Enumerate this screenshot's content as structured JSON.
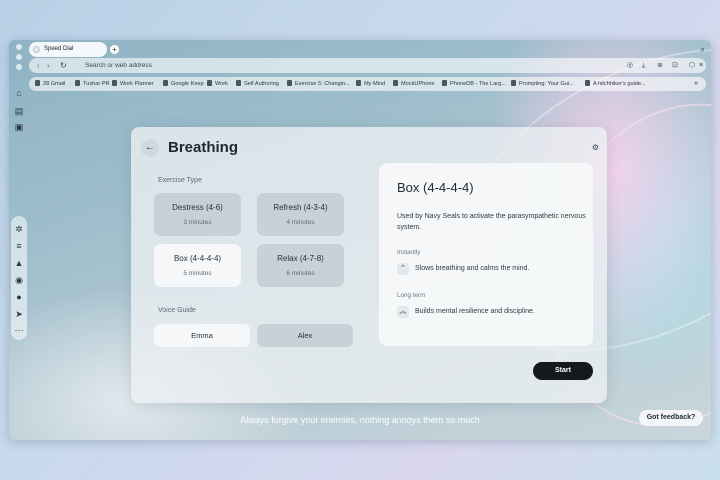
{
  "browser": {
    "tab_title": "Speed Dial",
    "new_tab_symbol": "+",
    "address_placeholder": "Search or web address",
    "bookmarks": [
      {
        "label": "28 Gmail"
      },
      {
        "label": "Tushar PR"
      },
      {
        "label": "Work Planner"
      },
      {
        "label": "Google Keep"
      },
      {
        "label": "Work"
      },
      {
        "label": "Self Authoring"
      },
      {
        "label": "Exercise 5: Changin..."
      },
      {
        "label": "My Mind"
      },
      {
        "label": "MockUPhone"
      },
      {
        "label": "PhoneDB - The Larg..."
      },
      {
        "label": "Prompting: Your Gui..."
      },
      {
        "label": "A hitchhiker's guide..."
      }
    ],
    "bookmarks_more": "»"
  },
  "breathing": {
    "title": "Breathing",
    "exercise_type_label": "Exercise Type",
    "exercises": [
      {
        "name": "Destress (4-6)",
        "duration": "3 minutes",
        "selected": false
      },
      {
        "name": "Refresh (4-3-4)",
        "duration": "4 minutes",
        "selected": false
      },
      {
        "name": "Box (4-4-4-4)",
        "duration": "5 minutes",
        "selected": true
      },
      {
        "name": "Relax (4-7-8)",
        "duration": "6 minutes",
        "selected": false
      }
    ],
    "voice_guide_label": "Voice Guide",
    "voices": [
      {
        "name": "Emma",
        "selected": true
      },
      {
        "name": "Alex",
        "selected": false
      }
    ],
    "detail": {
      "title": "Box (4-4-4-4)",
      "description": "Used by Navy Seals to activate the parasympathetic nervous system.",
      "instantly_label": "Instantly",
      "instantly_text": "Slows breathing and calms the mind.",
      "longterm_label": "Long term",
      "longterm_text": "Builds mental resilience and discipline."
    },
    "start_label": "Start"
  },
  "quote": "Always forgive your enemies, nothing annoys them so much",
  "feedback_label": "Got feedback?",
  "icons": {
    "back": "←",
    "settings": "⚙",
    "chevron_up": "⌃",
    "double_chevron_up": "︽"
  }
}
